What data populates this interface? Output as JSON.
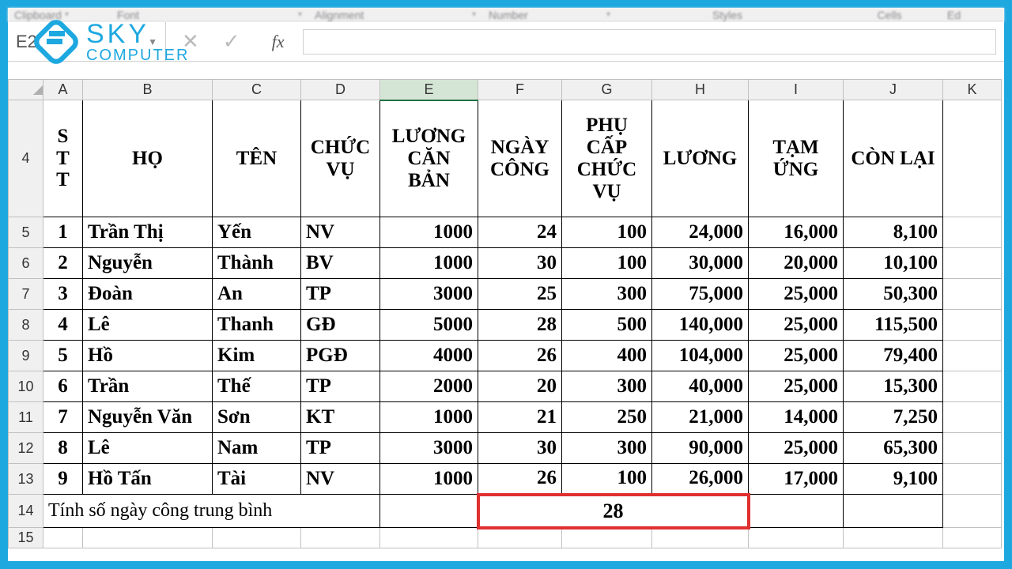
{
  "ribbon": {
    "clipboard": "Clipboard",
    "font": "Font",
    "alignment": "Alignment",
    "number": "Number",
    "styles": "Styles",
    "cells": "Cells",
    "editing": "Ed"
  },
  "namebox": "E2",
  "logo": {
    "line1": "SKY",
    "line2": "COMPUTER"
  },
  "cols": [
    "A",
    "B",
    "C",
    "D",
    "E",
    "F",
    "G",
    "H",
    "I",
    "J",
    "K"
  ],
  "rowlabels": [
    "4",
    "5",
    "6",
    "7",
    "8",
    "9",
    "10",
    "11",
    "12",
    "13",
    "14",
    "15"
  ],
  "headers": {
    "stt": "S\nT\nT",
    "ho": "HỌ",
    "ten": "TÊN",
    "chucvu": "CHỨC VỤ",
    "luongcb": "LƯƠNG CĂN BẢN",
    "ngaycong": "NGÀY CÔNG",
    "phucap": "PHỤ CẤP CHỨC VỤ",
    "luong": "LƯƠNG",
    "tamung": "TẠM ỨNG",
    "conlai": "CÒN LẠI"
  },
  "rows": [
    {
      "stt": "1",
      "ho": "Trần Thị",
      "ten": "Yến",
      "cv": "NV",
      "lcb": "1000",
      "nc": "24",
      "pc": "100",
      "luong": "24,000",
      "tu": "16,000",
      "cl": "8,100"
    },
    {
      "stt": "2",
      "ho": "Nguyễn",
      "ten": "Thành",
      "cv": "BV",
      "lcb": "1000",
      "nc": "30",
      "pc": "100",
      "luong": "30,000",
      "tu": "20,000",
      "cl": "10,100"
    },
    {
      "stt": "3",
      "ho": "Đoàn",
      "ten": "An",
      "cv": "TP",
      "lcb": "3000",
      "nc": "25",
      "pc": "300",
      "luong": "75,000",
      "tu": "25,000",
      "cl": "50,300"
    },
    {
      "stt": "4",
      "ho": "Lê",
      "ten": "Thanh",
      "cv": "GĐ",
      "lcb": "5000",
      "nc": "28",
      "pc": "500",
      "luong": "140,000",
      "tu": "25,000",
      "cl": "115,500"
    },
    {
      "stt": "5",
      "ho": "Hồ",
      "ten": "Kim",
      "cv": "PGĐ",
      "lcb": "4000",
      "nc": "26",
      "pc": "400",
      "luong": "104,000",
      "tu": "25,000",
      "cl": "79,400"
    },
    {
      "stt": "6",
      "ho": "Trần",
      "ten": "Thế",
      "cv": "TP",
      "lcb": "2000",
      "nc": "20",
      "pc": "300",
      "luong": "40,000",
      "tu": "25,000",
      "cl": "15,300"
    },
    {
      "stt": "7",
      "ho": "Nguyễn Văn",
      "ten": "Sơn",
      "cv": "KT",
      "lcb": "1000",
      "nc": "21",
      "pc": "250",
      "luong": "21,000",
      "tu": "14,000",
      "cl": "7,250"
    },
    {
      "stt": "8",
      "ho": "Lê",
      "ten": "Nam",
      "cv": "TP",
      "lcb": "3000",
      "nc": "30",
      "pc": "300",
      "luong": "90,000",
      "tu": "25,000",
      "cl": "65,300"
    },
    {
      "stt": "9",
      "ho": "Hồ Tấn",
      "ten": "Tài",
      "cv": "NV",
      "lcb": "1000",
      "nc": "26",
      "pc": "100",
      "luong": "26,000",
      "tu": "17,000",
      "cl": "9,100"
    }
  ],
  "summary": {
    "label": "Tính số ngày công trung bình",
    "value": "28"
  }
}
